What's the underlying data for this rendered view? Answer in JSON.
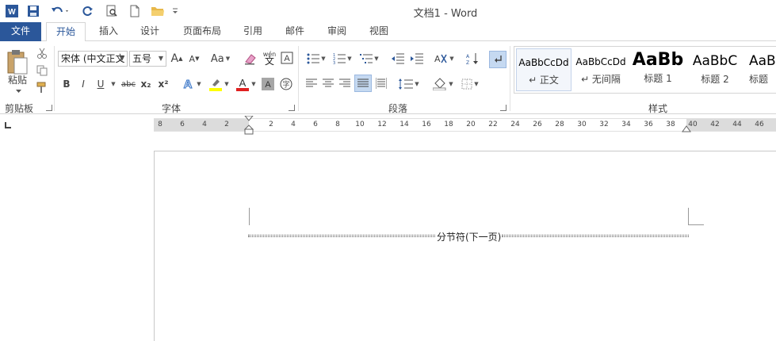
{
  "window": {
    "title": "文档1 - Word"
  },
  "qat": {
    "icons": [
      "word-logo-icon",
      "save-icon",
      "undo-icon",
      "redo-icon",
      "print-preview-icon",
      "new-document-icon",
      "open-folder-icon",
      "customize-qat-icon"
    ]
  },
  "tabs": [
    "文件",
    "开始",
    "插入",
    "设计",
    "页面布局",
    "引用",
    "邮件",
    "审阅",
    "视图"
  ],
  "ribbon": {
    "clipboard": {
      "paste_label": "粘贴",
      "group_label": "剪贴板"
    },
    "font": {
      "font_name": "宋体 (中文正文",
      "font_size": "五号",
      "bold": "B",
      "italic": "I",
      "underline": "U",
      "strike": "abc",
      "subscript": "x₂",
      "superscript": "x²",
      "grow": "A",
      "shrink": "A",
      "change_case": "Aa",
      "phonetic": "wén",
      "group_label": "字体"
    },
    "paragraph": {
      "group_label": "段落"
    },
    "styles": {
      "group_label": "样式",
      "items": [
        {
          "preview": "AaBbCcDd",
          "name": "↵ 正文"
        },
        {
          "preview": "AaBbCcDd",
          "name": "↵ 无间隔"
        },
        {
          "preview": "AaBb",
          "name": "标题 1"
        },
        {
          "preview": "AaBbC",
          "name": "标题 2"
        },
        {
          "preview": "AaBl",
          "name": "标题"
        }
      ]
    }
  },
  "ruler": {
    "ticks": [
      "8",
      "6",
      "4",
      "2",
      "2",
      "4",
      "6",
      "8",
      "10",
      "12",
      "14",
      "16",
      "18",
      "20",
      "22",
      "24",
      "26",
      "28",
      "30",
      "32",
      "34",
      "36",
      "38",
      "40",
      "42",
      "44",
      "46"
    ]
  },
  "document": {
    "section_break_text": "分节符(下一页)"
  },
  "colors": {
    "accent": "#2b579a",
    "highlight": "#ffff00",
    "font_color": "#e02020"
  }
}
